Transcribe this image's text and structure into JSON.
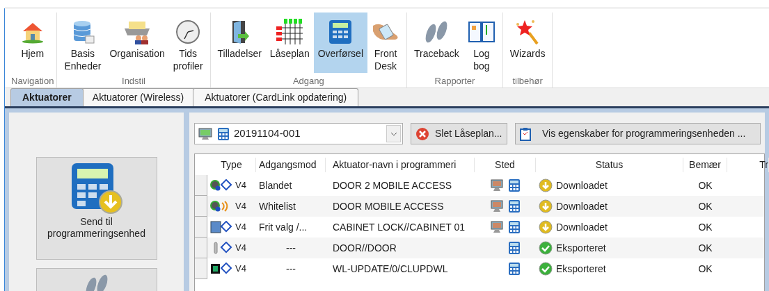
{
  "ribbon": [
    {
      "label": "Navigation",
      "items": [
        {
          "label": "Hjem",
          "selected": false
        }
      ]
    },
    {
      "label": "Indstil",
      "items": [
        {
          "label": "Basis\nEnheder",
          "selected": false
        },
        {
          "label": "Organisation",
          "selected": false
        },
        {
          "label": "Tids\nprofiler",
          "selected": false
        }
      ]
    },
    {
      "label": "Adgang",
      "items": [
        {
          "label": "Tilladelser",
          "selected": false
        },
        {
          "label": "Låseplan",
          "selected": false
        },
        {
          "label": "Overførsel",
          "selected": true
        },
        {
          "label": "Front\nDesk",
          "selected": false
        }
      ]
    },
    {
      "label": "Rapporter",
      "items": [
        {
          "label": "Traceback",
          "selected": false
        },
        {
          "label": "Log\nbog",
          "selected": false
        }
      ]
    },
    {
      "label": "tilbehør",
      "items": [
        {
          "label": "Wizards",
          "selected": false
        }
      ]
    }
  ],
  "tabs": [
    {
      "label": "Aktuatorer",
      "selected": true
    },
    {
      "label": "Aktuatorer (Wireless)",
      "selected": false
    },
    {
      "label": "Aktuatorer (CardLink opdatering)",
      "selected": false
    }
  ],
  "side_buttons": [
    {
      "label": "Send til\nprogrammeringsenhed"
    }
  ],
  "device_select": {
    "value": "20191104-001"
  },
  "toolbar_buttons": [
    {
      "label": "Slet Låseplan..."
    },
    {
      "label": "Vis egenskaber for programmeringsenheden ..."
    }
  ],
  "table": {
    "columns": [
      "Type",
      "Adgangsmod",
      "Aktuator-navn i programmeri",
      "Sted",
      "Status",
      "Bemær",
      "Tr"
    ],
    "rows": [
      {
        "kind": "mobile",
        "version": "V4",
        "mode": "Blandet",
        "name": "DOOR 2 MOBILE ACCESS",
        "on_pc": true,
        "on_device": true,
        "status": {
          "kind": "downloaded",
          "text": "Downloadet"
        },
        "remark": "OK"
      },
      {
        "kind": "wireless",
        "version": "V4",
        "mode": "Whitelist",
        "name": "DOOR MOBILE ACCESS",
        "on_pc": true,
        "on_device": true,
        "status": {
          "kind": "downloaded",
          "text": "Downloadet"
        },
        "remark": "OK"
      },
      {
        "kind": "cabinet",
        "version": "V4",
        "mode": "Frit valg /...",
        "name": "CABINET LOCK//CABINET 01",
        "on_pc": true,
        "on_device": true,
        "status": {
          "kind": "downloaded",
          "text": "Downloadet"
        },
        "remark": "OK"
      },
      {
        "kind": "handle",
        "version": "V4",
        "mode": "---",
        "name": "DOOR//DOOR",
        "on_pc": false,
        "on_device": true,
        "status": {
          "kind": "exported",
          "text": "Eksporteret"
        },
        "remark": "OK"
      },
      {
        "kind": "module",
        "version": "V4",
        "mode": "---",
        "name": "WL-UPDATE/0/CLUPDWL",
        "on_pc": false,
        "on_device": true,
        "status": {
          "kind": "exported",
          "text": "Eksporteret"
        },
        "remark": "OK"
      }
    ]
  }
}
